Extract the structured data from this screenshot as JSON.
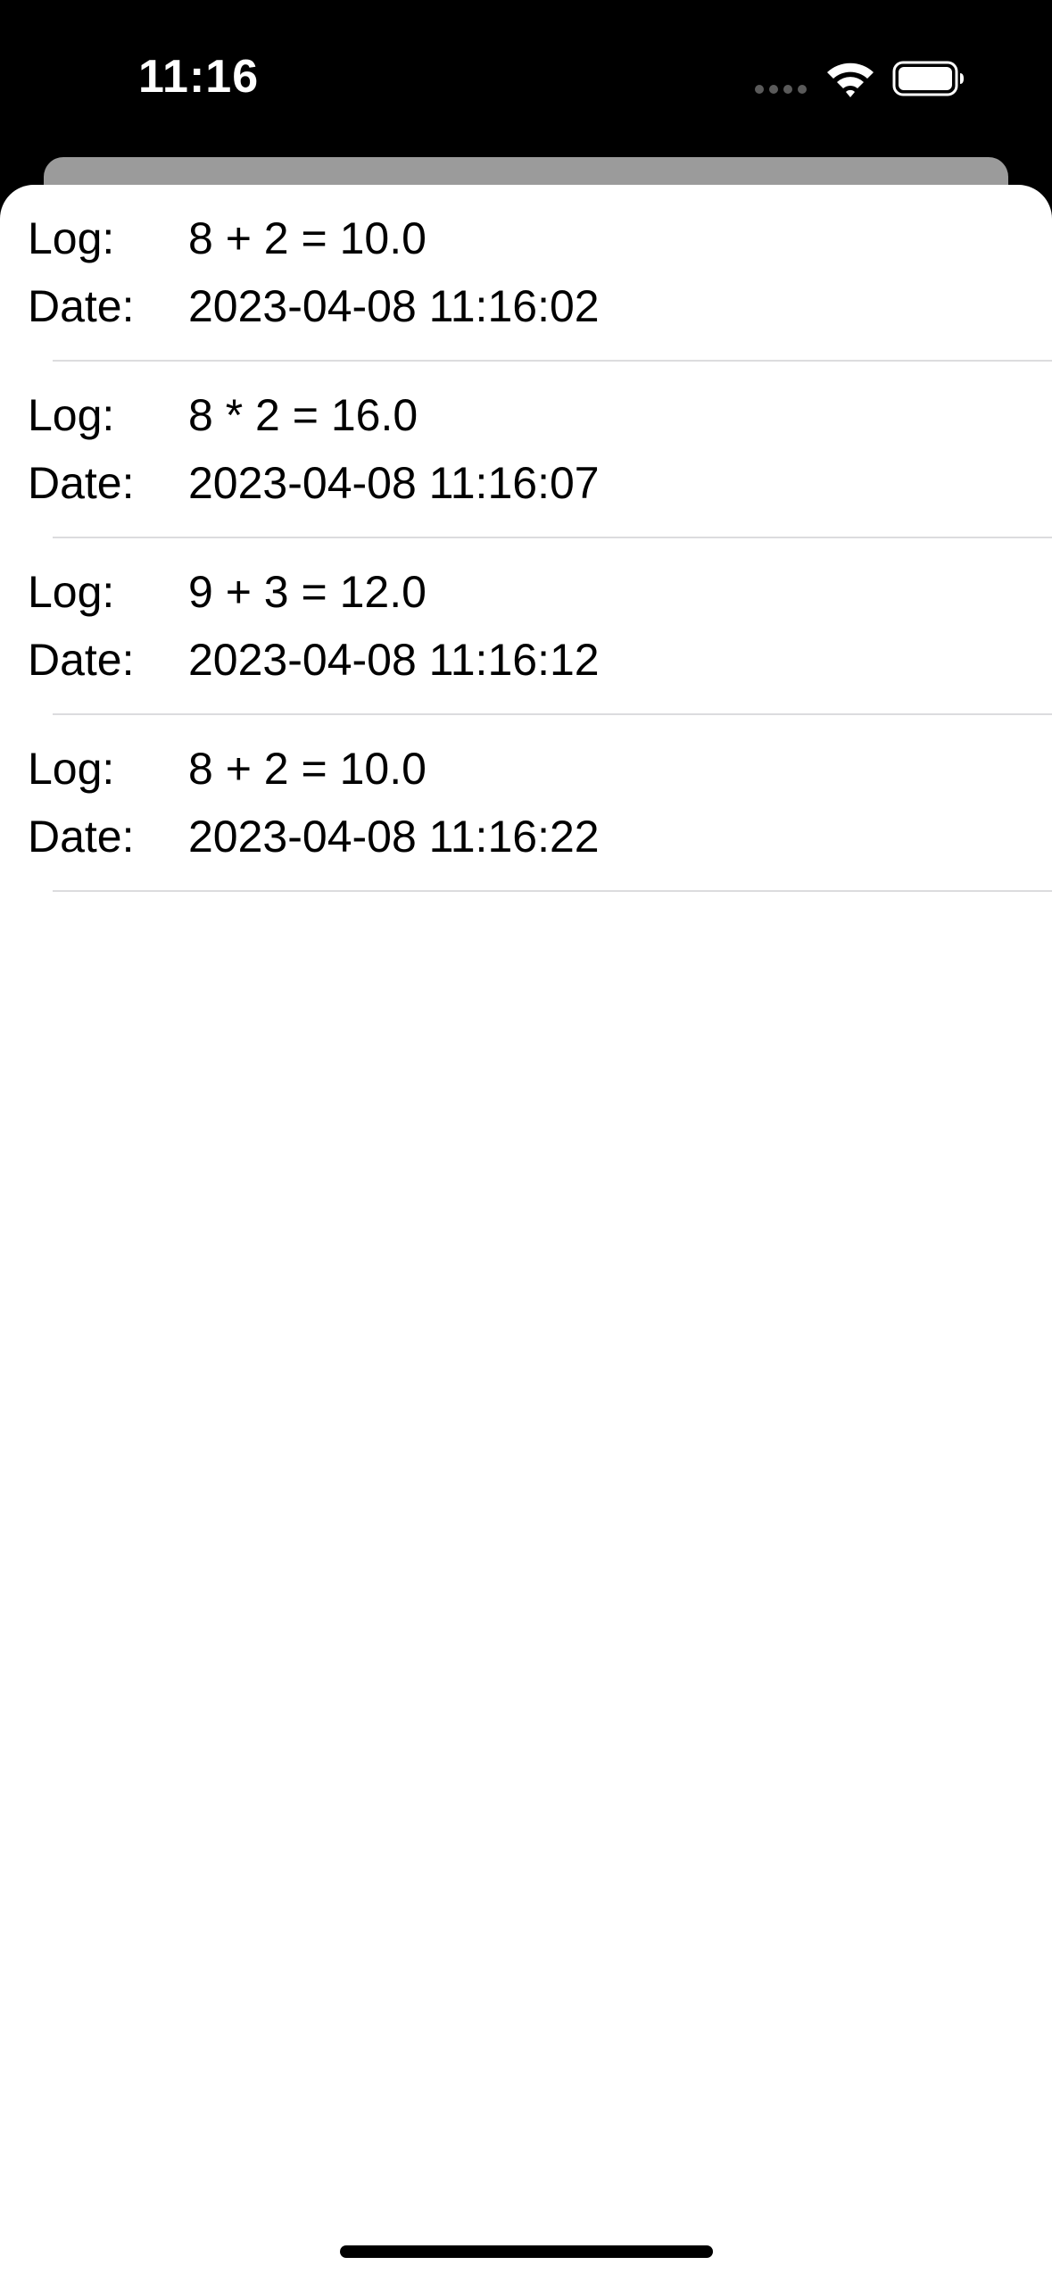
{
  "status_bar": {
    "time": "11:16",
    "icons": [
      "cellular-signal-icon",
      "wifi-icon",
      "battery-icon"
    ]
  },
  "log_list": {
    "labels": {
      "log": "Log:",
      "date": "Date:"
    },
    "entries": [
      {
        "log": "8 + 2 = 10.0",
        "date": "2023-04-08 11:16:02"
      },
      {
        "log": "8 * 2 = 16.0",
        "date": "2023-04-08 11:16:07"
      },
      {
        "log": "9 + 3 = 12.0",
        "date": "2023-04-08 11:16:12"
      },
      {
        "log": "8 + 2 = 10.0",
        "date": "2023-04-08 11:16:22"
      }
    ]
  },
  "colors": {
    "status_bar_background": "#000000",
    "back_sheet": "#9b9b9b",
    "sheet_background": "#ffffff",
    "separator": "#dcdcde",
    "text": "#000000"
  }
}
